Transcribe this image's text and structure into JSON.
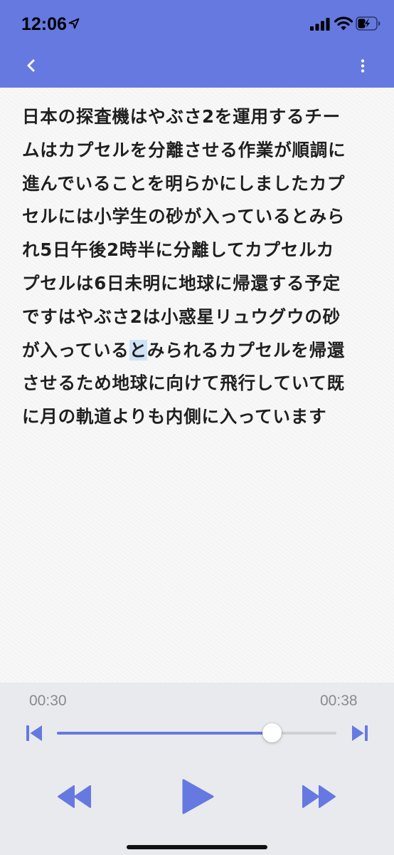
{
  "status_bar": {
    "time": "12:06",
    "icons": [
      "location-arrow-icon",
      "cellular-signal-icon",
      "wifi-icon",
      "battery-charging-icon"
    ]
  },
  "nav": {
    "back_icon": "chevron-left-icon",
    "menu_icon": "vertical-ellipsis-icon"
  },
  "transcript": {
    "lines": [
      "日本の探査機はやぶさ2を運用するチー",
      "ムはカプセルを分離させる作業が順調に",
      "進んでいることを明らかにしましたカプ",
      "セルには小学生の砂が入っているとみら",
      "れ5日午後2時半に分離してカプセルカ",
      "プセルは6日未明に地球に帰還する予定",
      "ですはやぶさ2は小惑星リュウグウの砂"
    ],
    "line8_before": "が入っている",
    "line8_highlight": "と",
    "line8_after": "みられるカプセルを帰還",
    "lines_after": [
      "させるため地球に向けて飛行していて既",
      "に月の軌道よりも内側に入っています"
    ]
  },
  "player": {
    "current_time": "00:30",
    "total_time": "00:38",
    "progress": 0.771,
    "icons": [
      "skip-to-start-icon",
      "skip-to-end-icon",
      "rewind-icon",
      "play-icon",
      "fast-forward-icon"
    ]
  },
  "colors": {
    "accent": "#6579e1",
    "highlight": "#cfe3f7",
    "player_bg": "#e9eaee",
    "time_text": "#8a8a8e"
  }
}
